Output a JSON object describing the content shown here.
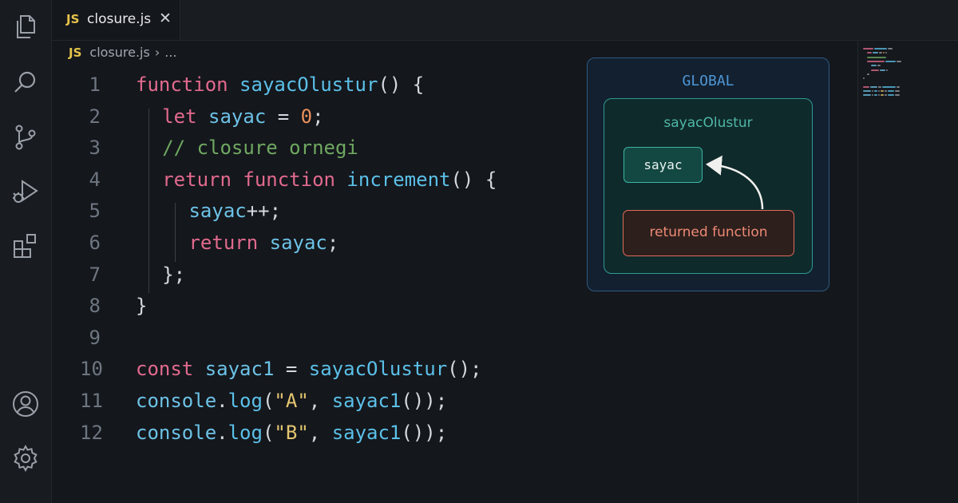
{
  "window": {
    "tab": {
      "lang_badge": "JS",
      "filename": "closure.js",
      "close_glyph": "✕"
    },
    "breadcrumb": {
      "lang_badge": "JS",
      "filename": "closure.js",
      "separator": "›",
      "ellipsis": "..."
    }
  },
  "activity_bar": {
    "icons": [
      "files-icon",
      "search-icon",
      "source-control-icon",
      "run-debug-icon",
      "extensions-icon"
    ],
    "bottom_icons": [
      "account-icon",
      "settings-gear-icon"
    ]
  },
  "editor": {
    "lines": [
      {
        "num": "1",
        "indent": 0,
        "tokens": [
          {
            "t": "kw",
            "v": "function "
          },
          {
            "t": "fn",
            "v": "sayacOlustur"
          },
          {
            "t": "op",
            "v": "() {"
          }
        ]
      },
      {
        "num": "2",
        "indent": 1,
        "tokens": [
          {
            "t": "kw",
            "v": "let "
          },
          {
            "t": "var",
            "v": "sayac"
          },
          {
            "t": "op",
            "v": " = "
          },
          {
            "t": "num",
            "v": "0"
          },
          {
            "t": "op",
            "v": ";"
          }
        ]
      },
      {
        "num": "3",
        "indent": 1,
        "tokens": [
          {
            "t": "cmt",
            "v": "// closure ornegi"
          }
        ]
      },
      {
        "num": "4",
        "indent": 1,
        "tokens": [
          {
            "t": "kw",
            "v": "return function "
          },
          {
            "t": "fn",
            "v": "increment"
          },
          {
            "t": "op",
            "v": "() {"
          }
        ]
      },
      {
        "num": "5",
        "indent": 2,
        "tokens": [
          {
            "t": "var",
            "v": "sayac"
          },
          {
            "t": "op",
            "v": "++;"
          }
        ]
      },
      {
        "num": "6",
        "indent": 2,
        "tokens": [
          {
            "t": "kw",
            "v": "return "
          },
          {
            "t": "var",
            "v": "sayac"
          },
          {
            "t": "op",
            "v": ";"
          }
        ]
      },
      {
        "num": "7",
        "indent": 1,
        "tokens": [
          {
            "t": "op",
            "v": "};"
          }
        ]
      },
      {
        "num": "8",
        "indent": 0,
        "tokens": [
          {
            "t": "op",
            "v": "}"
          }
        ]
      },
      {
        "num": "9",
        "indent": 0,
        "tokens": []
      },
      {
        "num": "10",
        "indent": 0,
        "tokens": [
          {
            "t": "kw",
            "v": "const "
          },
          {
            "t": "var",
            "v": "sayac1"
          },
          {
            "t": "op",
            "v": " = "
          },
          {
            "t": "fn",
            "v": "sayacOlustur"
          },
          {
            "t": "op",
            "v": "();"
          }
        ]
      },
      {
        "num": "11",
        "indent": 0,
        "tokens": [
          {
            "t": "prop",
            "v": "console"
          },
          {
            "t": "op",
            "v": "."
          },
          {
            "t": "fn",
            "v": "log"
          },
          {
            "t": "op",
            "v": "("
          },
          {
            "t": "str",
            "v": "\"A\""
          },
          {
            "t": "op",
            "v": ", "
          },
          {
            "t": "fn",
            "v": "sayac1"
          },
          {
            "t": "op",
            "v": "());"
          }
        ]
      },
      {
        "num": "12",
        "indent": 0,
        "tokens": [
          {
            "t": "prop",
            "v": "console"
          },
          {
            "t": "op",
            "v": "."
          },
          {
            "t": "fn",
            "v": "log"
          },
          {
            "t": "op",
            "v": "("
          },
          {
            "t": "str",
            "v": "\"B\""
          },
          {
            "t": "op",
            "v": ", "
          },
          {
            "t": "fn",
            "v": "sayac1"
          },
          {
            "t": "op",
            "v": "());"
          }
        ]
      }
    ]
  },
  "diagram": {
    "global_label": "GLOBAL",
    "scope_label": "sayacOlustur",
    "variable_label": "sayac",
    "function_label": "returned function"
  },
  "colors": {
    "keyword": "#e26a8e",
    "function": "#5bc0e8",
    "number": "#e9905b",
    "string": "#e5c670",
    "comment": "#6fa861",
    "js_badge": "#e5c34a"
  }
}
